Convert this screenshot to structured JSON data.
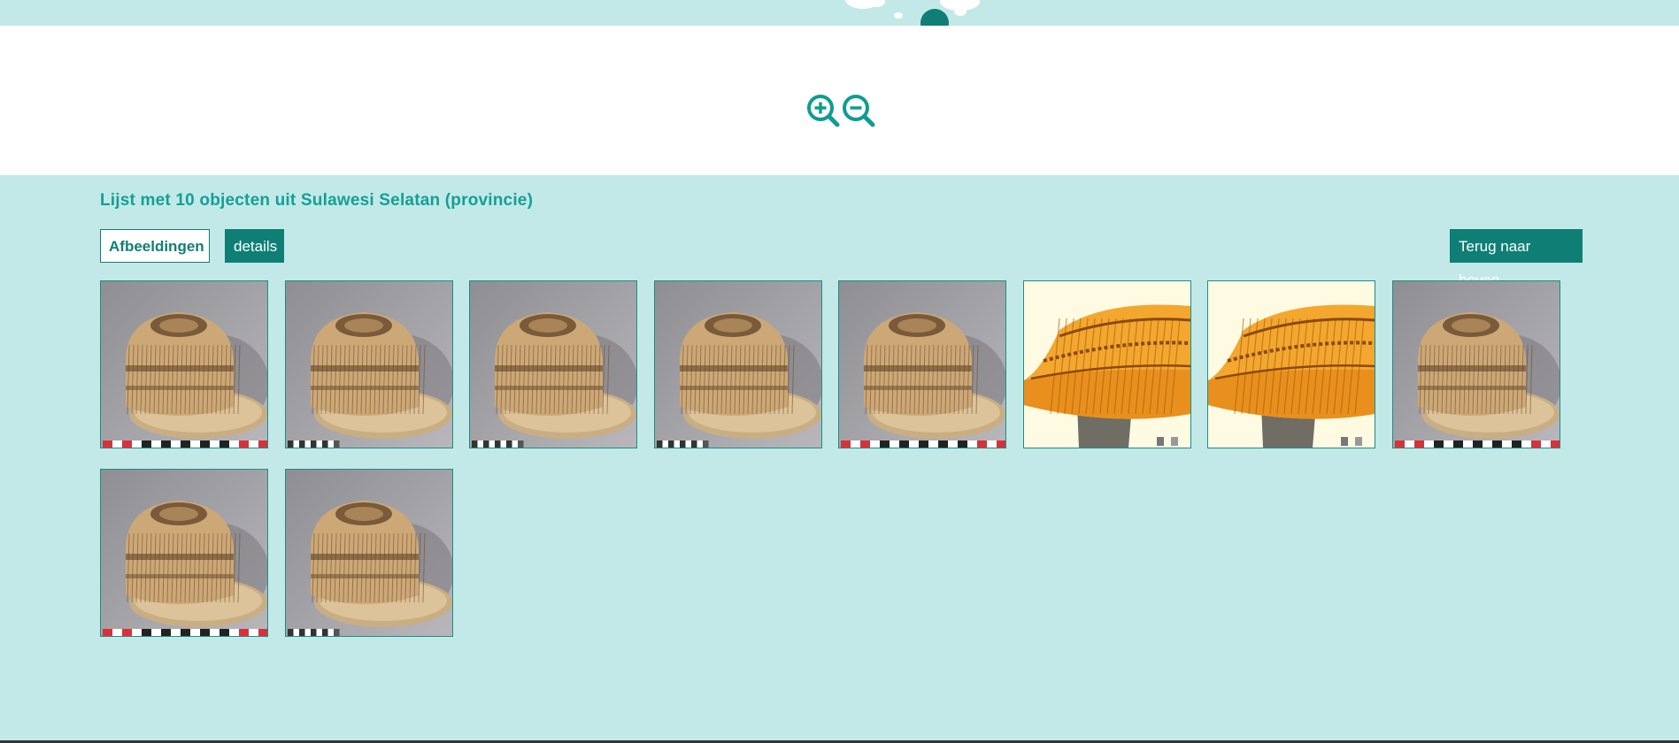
{
  "zoom": {
    "in_icon": "zoom-in-icon",
    "out_icon": "zoom-out-icon",
    "color": "#0f9c92"
  },
  "list": {
    "title": "Lijst met 10 objecten uit Sulawesi Selatan (provincie)",
    "count": 10
  },
  "buttons": {
    "images_label": "Afbeeldingen",
    "details_label": "details",
    "back_to_top_label": "Terug naar boven"
  },
  "thumbnails": [
    {
      "style": "woven-cap-gray-bg",
      "scale_bar": "red-white-black"
    },
    {
      "style": "woven-cap-gray-bg",
      "scale_bar": "black-white"
    },
    {
      "style": "woven-cap-gray-bg",
      "scale_bar": "black-white"
    },
    {
      "style": "woven-cap-gray-bg",
      "scale_bar": "black-white"
    },
    {
      "style": "woven-cap-gray-bg",
      "scale_bar": "red-white-black"
    },
    {
      "style": "yellow-hat-cream-bg",
      "scale_bar": "none"
    },
    {
      "style": "yellow-hat-cream-bg",
      "scale_bar": "none"
    },
    {
      "style": "woven-cap-gray-bg",
      "scale_bar": "red-white-black"
    },
    {
      "style": "woven-cap-gray-bg",
      "scale_bar": "red-white-black"
    },
    {
      "style": "woven-cap-gray-bg",
      "scale_bar": "black-white"
    }
  ],
  "colors": {
    "accent": "#0f7f76",
    "title": "#13a095",
    "background": "#c2e9e8"
  }
}
